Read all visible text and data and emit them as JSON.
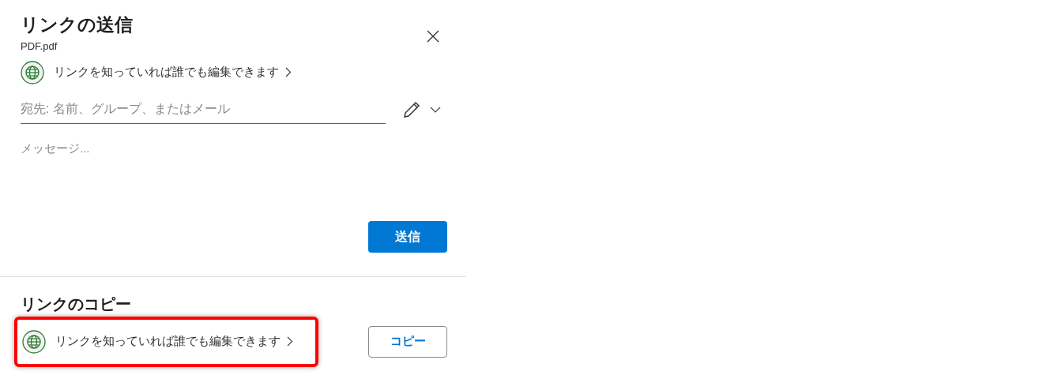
{
  "title": "リンクの送信",
  "file_name": "PDF.pdf",
  "send_section": {
    "permission": "リンクを知っていれば誰でも編集できます",
    "recipient_placeholder": "宛先: 名前、グループ、またはメール",
    "message_placeholder": "メッセージ...",
    "send_button": "送信"
  },
  "copy_section": {
    "title": "リンクのコピー",
    "permission": "リンクを知っていれば誰でも編集できます",
    "highlighted": true,
    "copy_button": "コピー"
  }
}
